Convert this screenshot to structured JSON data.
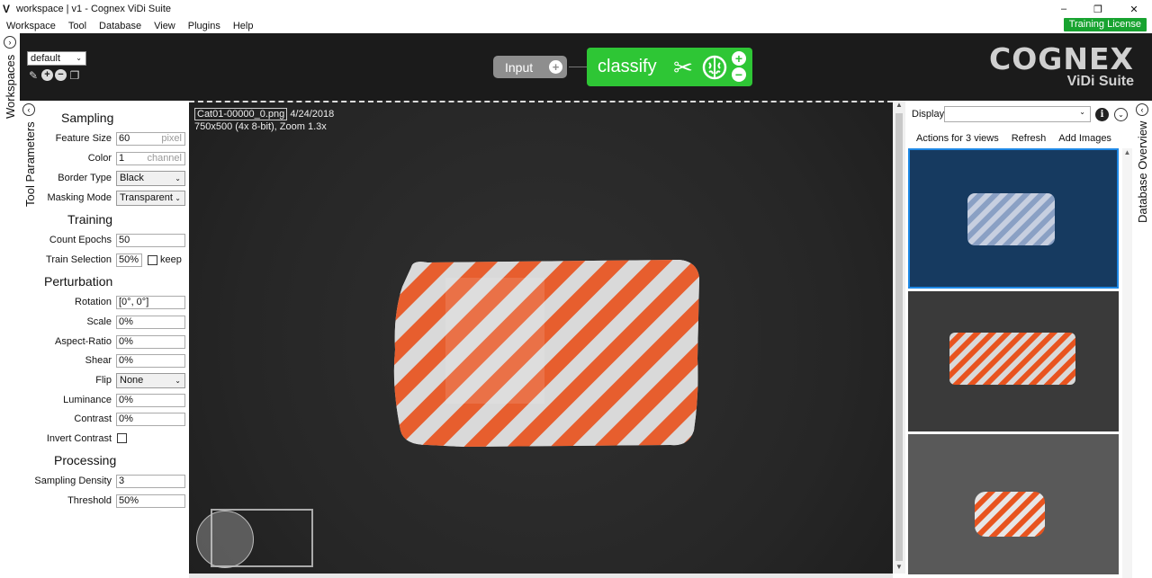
{
  "window": {
    "title": "workspace | v1 - Cognex ViDi Suite",
    "minimize": "–",
    "maximize": "❐",
    "close": "✕"
  },
  "menubar": [
    "Workspace",
    "Tool",
    "Database",
    "View",
    "Plugins",
    "Help"
  ],
  "license_badge": "Training License",
  "workspace": {
    "selected": "default",
    "side_tab_label": "Workspaces"
  },
  "pipeline": {
    "input_label": "Input",
    "classify_label": "classify"
  },
  "brand": {
    "name": "COGNEX",
    "product": "ViDi Suite"
  },
  "tool_parameters": {
    "side_tab_label": "Tool Parameters",
    "sections": {
      "sampling": "Sampling",
      "training": "Training",
      "perturbation": "Perturbation",
      "processing": "Processing"
    },
    "feature_size": {
      "label": "Feature Size",
      "value": "60",
      "unit": "pixel"
    },
    "color": {
      "label": "Color",
      "value": "1",
      "unit": "channel"
    },
    "border_type": {
      "label": "Border Type",
      "value": "Black"
    },
    "masking_mode": {
      "label": "Masking Mode",
      "value": "Transparent"
    },
    "count_epochs": {
      "label": "Count Epochs",
      "value": "50"
    },
    "train_selection": {
      "label": "Train Selection",
      "value": "50%",
      "keep_label": "keep"
    },
    "rotation": {
      "label": "Rotation",
      "value": "[0°, 0°]"
    },
    "scale": {
      "label": "Scale",
      "value": "0%"
    },
    "aspect_ratio": {
      "label": "Aspect-Ratio",
      "value": "0%"
    },
    "shear": {
      "label": "Shear",
      "value": "0%"
    },
    "flip": {
      "label": "Flip",
      "value": "None"
    },
    "luminance": {
      "label": "Luminance",
      "value": "0%"
    },
    "contrast": {
      "label": "Contrast",
      "value": "0%"
    },
    "invert_contrast": {
      "label": "Invert Contrast"
    },
    "sampling_density": {
      "label": "Sampling Density",
      "value": "3"
    },
    "threshold": {
      "label": "Threshold",
      "value": "50%"
    }
  },
  "viewer": {
    "filename": "Cat01-00000_0.png",
    "date": "4/24/2018",
    "details": "750x500 (4x 8-bit), Zoom 1.3x",
    "overlay_color": "#e8541f"
  },
  "database": {
    "side_tab_label": "Database Overview",
    "display_label": "Display",
    "display_value": "",
    "actions": {
      "summary": "Actions for 3 views",
      "refresh": "Refresh",
      "add_images": "Add Images"
    },
    "selection_color": "#1e88e5"
  }
}
